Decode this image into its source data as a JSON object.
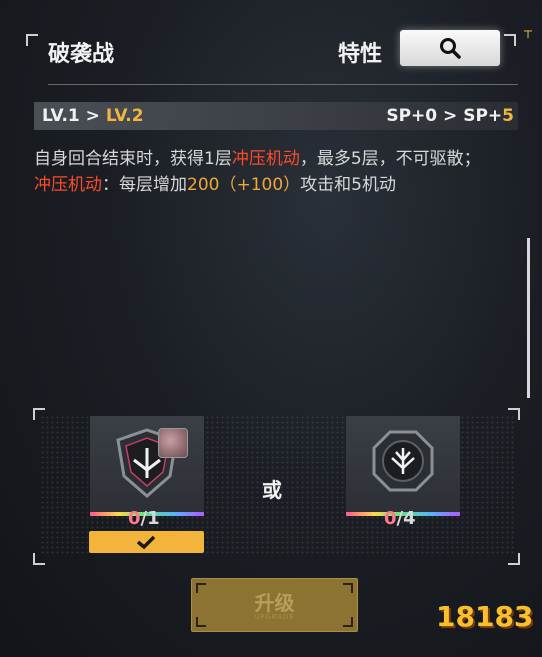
{
  "header": {
    "title": "破袭战",
    "trait_label": "特性"
  },
  "level": {
    "from": "LV.1",
    "arrow": " > ",
    "to": "LV.2",
    "sp_from": "SP+0",
    "sp_arrow": " > ",
    "sp_prefix": "SP+",
    "sp_to": "5"
  },
  "description": {
    "line1_a": "自身回合结束时，获得1层",
    "line1_keyword": "冲压机动",
    "line1_b": "，最多5层，不可驱散；",
    "line2_keyword": "冲压机动",
    "line2_a": "：每层增加",
    "line2_value": "200（+100）",
    "line2_b": "攻击和5机动"
  },
  "materials": {
    "or_label": "或",
    "items": [
      {
        "name": "chip-material-1",
        "owned": "0",
        "required": "/1"
      },
      {
        "name": "chip-material-2",
        "owned": "0",
        "required": "/4"
      }
    ]
  },
  "upgrade": {
    "label": "升级",
    "sub_label": "UPGRADE"
  },
  "colors": {
    "accent_gold": "#f2b640",
    "keyword_red": "#ff4a2a",
    "count_red": "#ff7a8a",
    "upgrade_btn": "#8c7334"
  },
  "watermark": "18183"
}
